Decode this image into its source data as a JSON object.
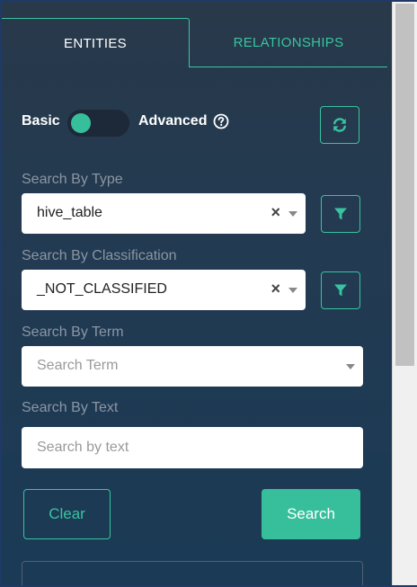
{
  "tabs": {
    "entities": "ENTITIES",
    "relationships": "RELATIONSHIPS"
  },
  "mode": {
    "basic_label": "Basic",
    "advanced_label": "Advanced",
    "toggle_state": "basic"
  },
  "search_by_type": {
    "label": "Search By Type",
    "value": "hive_table"
  },
  "search_by_classification": {
    "label": "Search By Classification",
    "value": "_NOT_CLASSIFIED"
  },
  "search_by_term": {
    "label": "Search By Term",
    "placeholder": "Search Term"
  },
  "search_by_text": {
    "label": "Search By Text",
    "placeholder": "Search by text"
  },
  "buttons": {
    "clear": "Clear",
    "search": "Search"
  },
  "clear_glyph": "×",
  "colors": {
    "accent": "#37bf9b",
    "panel_bg": "#223a52",
    "label_text": "#8b96a3"
  },
  "icons": {
    "refresh": "refresh-icon",
    "filter": "filter-icon",
    "help": "question-circle-icon"
  }
}
